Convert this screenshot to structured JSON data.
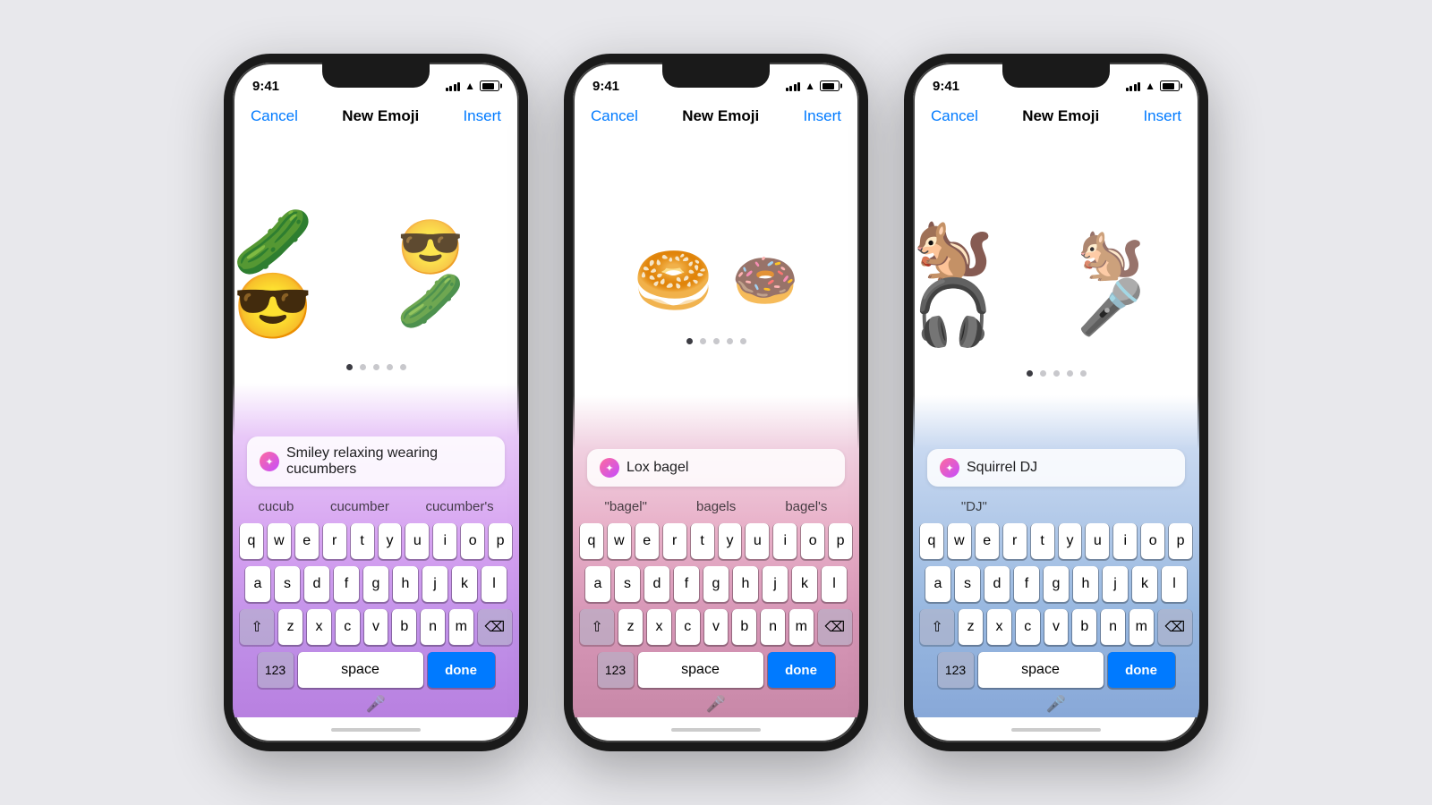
{
  "background": "#e8e8ec",
  "phones": [
    {
      "id": "phone-1",
      "keyboardBg": "keyboard-bg-1",
      "statusTime": "9:41",
      "nav": {
        "cancel": "Cancel",
        "title": "New Emoji",
        "insert": "Insert"
      },
      "emojis": [
        "🥒😎",
        "🥒😎"
      ],
      "emojiDisplay": [
        "🥒😎",
        "😎🥒"
      ],
      "searchText": "Smiley relaxing wearing cucumbers",
      "suggestions": [
        "cucub",
        "cucumber",
        "cucumber's"
      ],
      "keys": {
        "row1": [
          "q",
          "w",
          "e",
          "r",
          "t",
          "y",
          "u",
          "i",
          "o",
          "p"
        ],
        "row2": [
          "a",
          "s",
          "d",
          "f",
          "g",
          "h",
          "j",
          "k",
          "l"
        ],
        "row3": [
          "z",
          "x",
          "c",
          "v",
          "b",
          "n",
          "m"
        ],
        "nums": "123",
        "space": "space",
        "done": "done"
      }
    },
    {
      "id": "phone-2",
      "keyboardBg": "keyboard-bg-2",
      "statusTime": "9:41",
      "nav": {
        "cancel": "Cancel",
        "title": "New Emoji",
        "insert": "Insert"
      },
      "searchText": "Lox bagel",
      "suggestions": [
        "\"bagel\"",
        "bagels",
        "bagel's"
      ],
      "keys": {
        "row1": [
          "q",
          "w",
          "e",
          "r",
          "t",
          "y",
          "u",
          "i",
          "o",
          "p"
        ],
        "row2": [
          "a",
          "s",
          "d",
          "f",
          "g",
          "h",
          "j",
          "k",
          "l"
        ],
        "row3": [
          "z",
          "x",
          "c",
          "v",
          "b",
          "n",
          "m"
        ],
        "nums": "123",
        "space": "space",
        "done": "done"
      }
    },
    {
      "id": "phone-3",
      "keyboardBg": "keyboard-bg-3",
      "statusTime": "9:41",
      "nav": {
        "cancel": "Cancel",
        "title": "New Emoji",
        "insert": "Insert"
      },
      "searchText": "Squirrel DJ",
      "suggestions": [
        "\"DJ\"",
        "",
        ""
      ],
      "keys": {
        "row1": [
          "q",
          "w",
          "e",
          "r",
          "t",
          "y",
          "u",
          "i",
          "o",
          "p"
        ],
        "row2": [
          "a",
          "s",
          "d",
          "f",
          "g",
          "h",
          "j",
          "k",
          "l"
        ],
        "row3": [
          "z",
          "x",
          "c",
          "v",
          "b",
          "n",
          "m"
        ],
        "nums": "123",
        "space": "space",
        "done": "done"
      }
    }
  ]
}
